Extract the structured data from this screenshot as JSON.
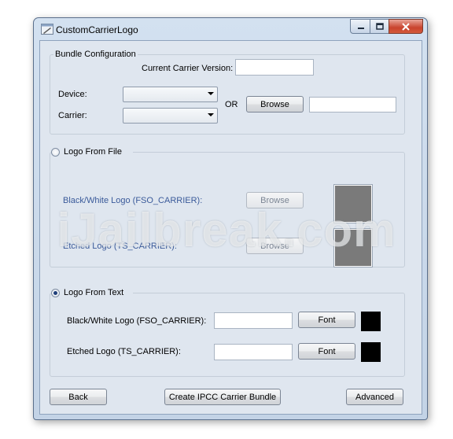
{
  "window": {
    "title": "CustomCarrierLogo"
  },
  "bundle_config": {
    "legend": "Bundle Configuration",
    "current_carrier_version_label": "Current Carrier Version:",
    "current_carrier_version_value": "",
    "device_label": "Device:",
    "device_selected": "",
    "carrier_label": "Carrier:",
    "carrier_selected": "",
    "or_label": "OR",
    "browse_label": "Browse",
    "path_value": ""
  },
  "logo_from_file": {
    "radio_label": "Logo From File",
    "selected": false,
    "bw_logo_label": "Black/White Logo  (FSO_CARRIER):",
    "bw_browse_label": "Browse",
    "etched_logo_label": "Etched Logo (TS_CARRIER):",
    "etched_browse_label": "Browse",
    "preview_color": "#7a7a7a"
  },
  "logo_from_text": {
    "radio_label": "Logo From Text",
    "selected": true,
    "bw_logo_label": "Black/White Logo  (FSO_CARRIER):",
    "bw_text_value": "",
    "bw_font_label": "Font",
    "etched_logo_label": "Etched Logo (TS_CARRIER):",
    "etched_text_value": "",
    "etched_font_label": "Font",
    "swatch_color": "#000000"
  },
  "footer": {
    "back_label": "Back",
    "create_label": "Create IPCC Carrier Bundle",
    "advanced_label": "Advanced"
  },
  "watermark": "iJailbreak.com"
}
